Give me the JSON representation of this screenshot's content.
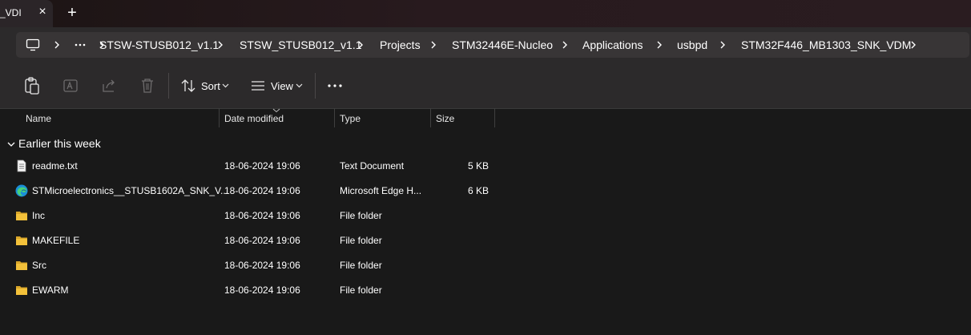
{
  "tab": {
    "label": "_VDI"
  },
  "breadcrumb": {
    "items": [
      "STSW-STUSB012_v1.1",
      "STSW_STUSB012_v1.1",
      "Projects",
      "STM32446E-Nucleo",
      "Applications",
      "usbpd",
      "STM32F446_MB1303_SNK_VDM"
    ]
  },
  "toolbar": {
    "sort_label": "Sort",
    "view_label": "View"
  },
  "columns": {
    "name": "Name",
    "date": "Date modified",
    "type": "Type",
    "size": "Size"
  },
  "group": {
    "label": "Earlier this week"
  },
  "files": [
    {
      "name": "readme.txt",
      "date": "18-06-2024 19:06",
      "type": "Text Document",
      "size": "5 KB",
      "icon": "text-file-icon"
    },
    {
      "name": "STMicroelectronics__STUSB1602A_SNK_V...",
      "date": "18-06-2024 19:06",
      "type": "Microsoft Edge H...",
      "size": "6 KB",
      "icon": "edge-icon"
    },
    {
      "name": "Inc",
      "date": "18-06-2024 19:06",
      "type": "File folder",
      "size": "",
      "icon": "folder-icon"
    },
    {
      "name": "MAKEFILE",
      "date": "18-06-2024 19:06",
      "type": "File folder",
      "size": "",
      "icon": "folder-icon"
    },
    {
      "name": "Src",
      "date": "18-06-2024 19:06",
      "type": "File folder",
      "size": "",
      "icon": "folder-icon"
    },
    {
      "name": "EWARM",
      "date": "18-06-2024 19:06",
      "type": "File folder",
      "size": "",
      "icon": "folder-icon"
    }
  ],
  "colors": {
    "background": "#191919",
    "toolbar": "#2c2a2b",
    "address": "#383536",
    "folder": "#f3c13a",
    "text": "#ffffff"
  }
}
